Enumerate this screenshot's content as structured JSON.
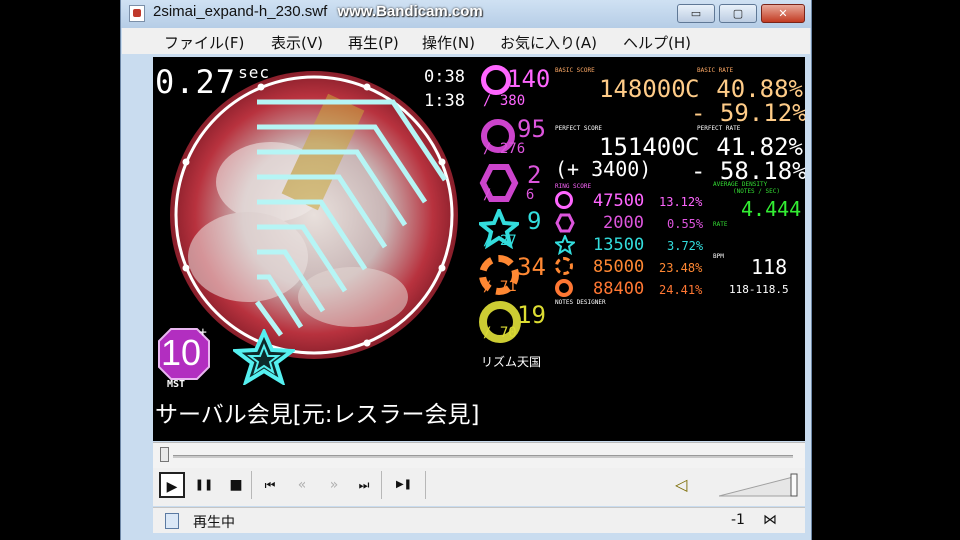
{
  "window": {
    "title": "2simai_expand-h_230.swf",
    "controls": {
      "minimize": "▭",
      "restore": "▢",
      "close": "✕"
    }
  },
  "watermark": "www.Bandicam.com",
  "menu": [
    {
      "label": "ファイル(F)"
    },
    {
      "label": "表示(V)"
    },
    {
      "label": "再生(P)"
    },
    {
      "label": "操作(N)"
    },
    {
      "label": "お気に入り(A)"
    },
    {
      "label": "ヘルプ(H)"
    }
  ],
  "game": {
    "offset": "0.27",
    "offset_unit": "sec",
    "time_current": "0:38",
    "time_total": "1:38",
    "song_title": "サーバル会見[元:レスラー会見]",
    "level": "10",
    "level_plus": "+",
    "difficulty": "MST",
    "designer": "リズム天国",
    "accent_magenta": "#cc33cc",
    "counters": [
      {
        "hit": "140",
        "total": "380",
        "icon": "tap-icon",
        "color": "#ff66ff"
      },
      {
        "hit": "95",
        "total": "276",
        "icon": "tap-icon",
        "color": "#cc44cc"
      },
      {
        "hit": "2",
        "total": "6",
        "icon": "hold-icon",
        "color": "#cc44cc"
      },
      {
        "hit": "9",
        "total": "27",
        "icon": "slide-star-icon",
        "color": "#33dddd"
      },
      {
        "hit": "34",
        "total": "71",
        "icon": "touch-icon",
        "color": "#ff8833"
      },
      {
        "hit": "19",
        "total": "70",
        "icon": "break-icon",
        "color": "#dddd33"
      }
    ],
    "basic_score_label": "BASIC SCORE",
    "basic_score": "148000",
    "basic_score_rank": "C",
    "basic_rate_label": "BASIC RATE",
    "basic_rate": "40.88%",
    "basic_rate_diff": "- 59.12%",
    "perfect_score_label": "PERFECT SCORE",
    "perfect_score": "151400",
    "perfect_score_rank": "C",
    "perfect_score_diff": "(+ 3400)",
    "perfect_rate_label": "PERFECT RATE",
    "perfect_rate": "41.82%",
    "perfect_rate_diff": "- 58.18%",
    "ring_score_label": "RING SCORE",
    "breakdown": [
      {
        "score": "47500",
        "pct": "13.12%",
        "icon": "ring-icon",
        "color": "#ff66ff"
      },
      {
        "score": "2000",
        "pct": "0.55%",
        "icon": "hex-icon",
        "color": "#dd55dd"
      },
      {
        "score": "13500",
        "pct": "3.72%",
        "icon": "star-icon",
        "color": "#33dddd"
      },
      {
        "score": "85000",
        "pct": "23.48%",
        "icon": "sun-icon",
        "color": "#ff8833"
      },
      {
        "score": "88400",
        "pct": "24.41%",
        "icon": "break-ring-icon",
        "color": "#ff7733"
      }
    ],
    "density_label": "AVERAGE DENSITY",
    "density_sub": "(NOTES / SEC)",
    "density": "4.444",
    "bpm_label": "BPM",
    "bpm": "118",
    "bpm_range": "118-118.5",
    "notes_designer_label": "NOTES DESIGNER",
    "rate_diff_label": "RATE"
  },
  "player": {
    "play": "▶",
    "pause": "❚❚",
    "stop": "■",
    "prev": "⏮",
    "rew": "«",
    "ff": "»",
    "next": "⏭",
    "step": "▶❚",
    "volume": "◁"
  },
  "status": {
    "text": "再生中",
    "value": "-1",
    "grip": "⋈"
  }
}
